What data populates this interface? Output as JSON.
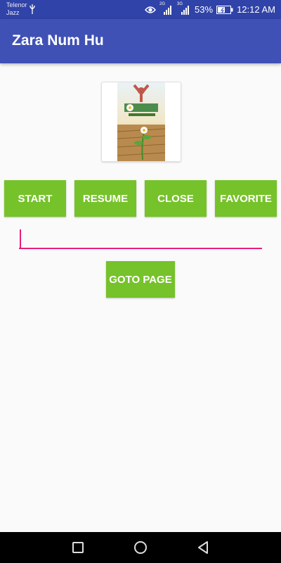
{
  "status_bar": {
    "carrier_line1": "Telenor",
    "carrier_line2": "Jazz",
    "net1": "2G",
    "net2": "3G",
    "battery": "53%",
    "time": "12:12 AM"
  },
  "app_bar": {
    "title": "Zara Num Hu"
  },
  "buttons": {
    "start": "START",
    "resume": "RESUME",
    "close": "CLOSE",
    "favorite": "FAVORITE",
    "goto_page": "GOTO PAGE"
  },
  "page_input": {
    "value": ""
  },
  "colors": {
    "status_bar": "#3043a8",
    "app_bar": "#3f51b5",
    "button": "#76c22a",
    "input_underline": "#e91e78"
  },
  "icons": {
    "usb": "usb-icon",
    "eye": "eye-icon",
    "signal": "signal-icon",
    "battery": "battery-icon",
    "nav_recents": "square-icon",
    "nav_home": "circle-icon",
    "nav_back": "triangle-back-icon"
  }
}
